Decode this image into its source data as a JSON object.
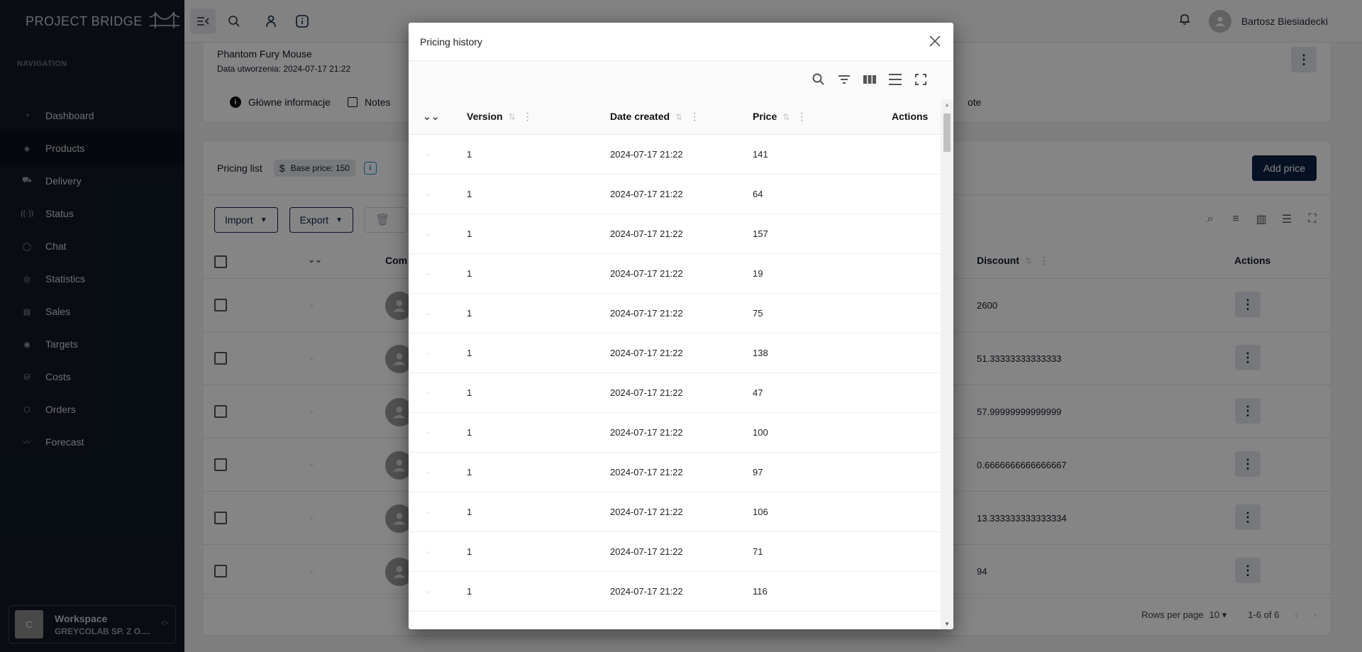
{
  "app": {
    "brand": "PROJECT BRIDGE"
  },
  "sidebar": {
    "nav_title": "NAVIGATION",
    "items": [
      {
        "label": "Dashboard",
        "icon": "gauge-icon",
        "active": false
      },
      {
        "label": "Products",
        "icon": "layers-icon",
        "active": true
      },
      {
        "label": "Delivery",
        "icon": "truck-icon",
        "active": false
      },
      {
        "label": "Status",
        "icon": "broadcast-icon",
        "active": false
      },
      {
        "label": "Chat",
        "icon": "chat-bubble-icon",
        "active": false
      },
      {
        "label": "Statistics",
        "icon": "refresh-circle-icon",
        "active": false
      },
      {
        "label": "Sales",
        "icon": "clipboard-chart-icon",
        "active": false
      },
      {
        "label": "Targets",
        "icon": "target-icon",
        "active": false
      },
      {
        "label": "Costs",
        "icon": "coins-icon",
        "active": false
      },
      {
        "label": "Orders",
        "icon": "box-icon",
        "active": false
      },
      {
        "label": "Forecast",
        "icon": "trend-line-icon",
        "active": false
      }
    ],
    "workspace": {
      "avatar": "C",
      "title": "Workspace",
      "subtitle": "GREYCOLAB SP. Z O...."
    }
  },
  "topbar": {
    "user_name": "Bartosz Biesiadecki"
  },
  "product": {
    "name": "Phantom Fury Mouse",
    "created": "Data utworzenia: 2024-07-17 21:22",
    "tabs": [
      {
        "label": "Główne informacje"
      },
      {
        "label": "Notes"
      }
    ],
    "tab_partial": "ote"
  },
  "pricing": {
    "title": "Pricing list",
    "base_price": "Base price: 150",
    "add_price": "Add price",
    "import": "Import",
    "export": "Export",
    "col_company": "Com",
    "col_discount": "Discount",
    "col_actions": "Actions",
    "rows": [
      {
        "discount": "2600"
      },
      {
        "discount": "51.33333333333333"
      },
      {
        "discount": "57.99999999999999"
      },
      {
        "discount": "0.6666666666666667"
      },
      {
        "discount": "13.333333333333334"
      },
      {
        "discount": "94"
      }
    ],
    "rows_per_page_label": "Rows per page",
    "rows_per_page": "10",
    "range": "1-6 of 6"
  },
  "modal": {
    "title": "Pricing history",
    "columns": {
      "version": "Version",
      "date": "Date created",
      "price": "Price",
      "actions": "Actions"
    },
    "rows": [
      {
        "version": "1",
        "date": "2024-07-17 21:22",
        "price": "141"
      },
      {
        "version": "1",
        "date": "2024-07-17 21:22",
        "price": "64"
      },
      {
        "version": "1",
        "date": "2024-07-17 21:22",
        "price": "157"
      },
      {
        "version": "1",
        "date": "2024-07-17 21:22",
        "price": "19"
      },
      {
        "version": "1",
        "date": "2024-07-17 21:22",
        "price": "75"
      },
      {
        "version": "1",
        "date": "2024-07-17 21:22",
        "price": "138"
      },
      {
        "version": "1",
        "date": "2024-07-17 21:22",
        "price": "47"
      },
      {
        "version": "1",
        "date": "2024-07-17 21:22",
        "price": "100"
      },
      {
        "version": "1",
        "date": "2024-07-17 21:22",
        "price": "97"
      },
      {
        "version": "1",
        "date": "2024-07-17 21:22",
        "price": "106"
      },
      {
        "version": "1",
        "date": "2024-07-17 21:22",
        "price": "71"
      },
      {
        "version": "1",
        "date": "2024-07-17 21:22",
        "price": "116"
      }
    ]
  }
}
